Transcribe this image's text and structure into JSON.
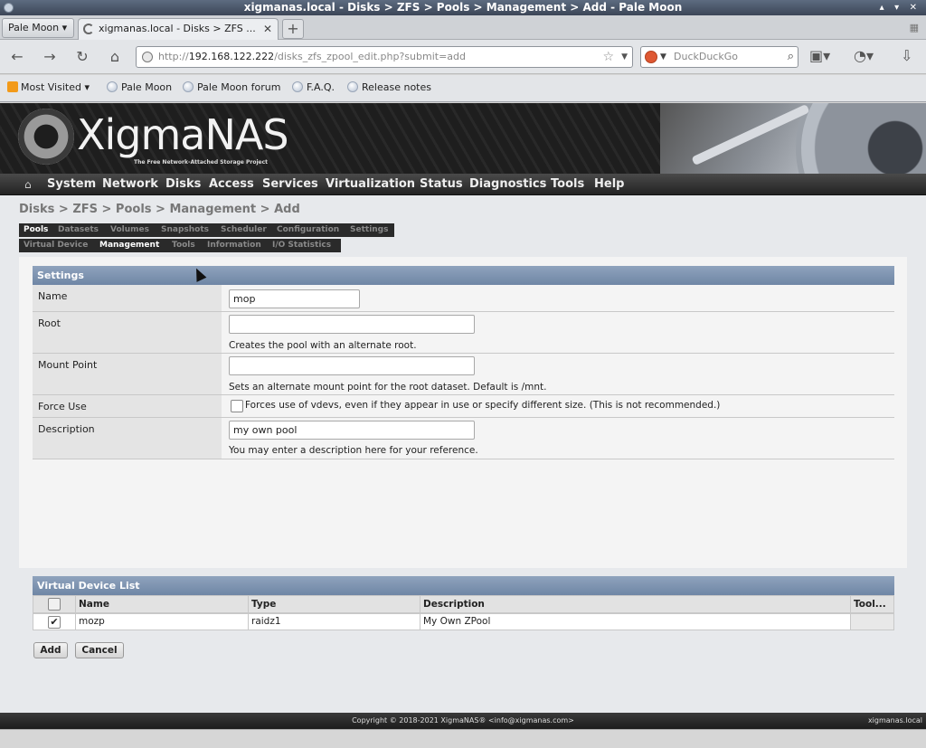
{
  "window": {
    "title": "xigmanas.local - Disks > ZFS > Pools > Management > Add - Pale Moon"
  },
  "browser": {
    "menu_button": "Pale Moon",
    "tab_title": "xigmanas.local - Disks > ZFS ...",
    "url_prefix": "http://",
    "url_host": "192.168.122.222",
    "url_path": "/disks_zfs_zpool_edit.php?submit=add",
    "search_placeholder": "DuckDuckGo",
    "bookmarks": [
      "Most Visited",
      "Pale Moon",
      "Pale Moon forum",
      "F.A.Q.",
      "Release notes"
    ]
  },
  "banner": {
    "logo": "XigmaNAS",
    "tagline": "The Free Network-Attached Storage Project"
  },
  "menu": [
    "System",
    "Network",
    "Disks",
    "Access",
    "Services",
    "Virtualization",
    "Status",
    "Diagnostics",
    "Tools",
    "Help"
  ],
  "breadcrumb": "Disks > ZFS > Pools > Management > Add",
  "tabs_row1": [
    "Pools",
    "Datasets",
    "Volumes",
    "Snapshots",
    "Scheduler",
    "Configuration",
    "Settings"
  ],
  "tabs_row2": [
    "Virtual Device",
    "Management",
    "Tools",
    "Information",
    "I/O Statistics"
  ],
  "settings": {
    "header": "Settings",
    "name_label": "Name",
    "name_value": "mop",
    "root_label": "Root",
    "root_value": "",
    "root_hint": "Creates the pool with an alternate root.",
    "mount_label": "Mount Point",
    "mount_value": "",
    "mount_hint": "Sets an alternate mount point for the root dataset. Default is /mnt.",
    "force_label": "Force Use",
    "force_hint": "Forces use of vdevs, even if they appear in use or specify different size. (This is not recommended.)",
    "desc_label": "Description",
    "desc_value": "my own pool",
    "desc_hint": "You may enter a description here for your reference."
  },
  "vdevs": {
    "header": "Virtual Device List",
    "columns": [
      "Name",
      "Type",
      "Description",
      "Tool..."
    ],
    "rows": [
      {
        "name": "mozp",
        "type": "raidz1",
        "description": "My Own ZPool",
        "checked": true
      }
    ]
  },
  "buttons": {
    "add": "Add",
    "cancel": "Cancel"
  },
  "footer": {
    "copyright": "Copyright © 2018-2021 XigmaNAS® <info@xigmanas.com>",
    "host": "xigmanas.local"
  }
}
